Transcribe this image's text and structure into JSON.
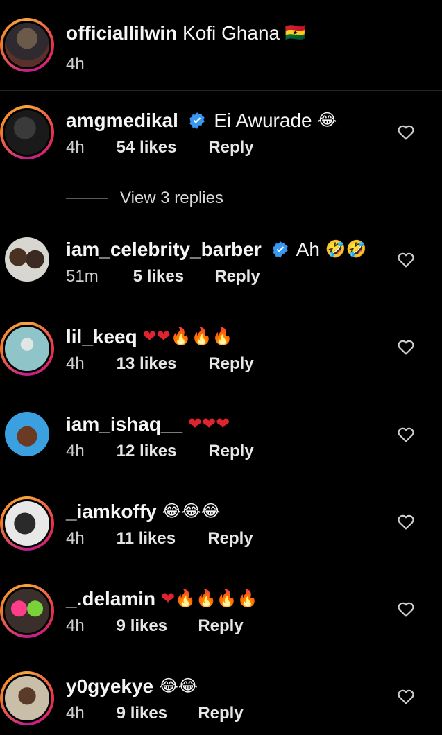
{
  "caption": {
    "username": "officiallilwin",
    "text": "Kofi Ghana",
    "flag_emoji": "🇬🇭",
    "time": "4h"
  },
  "view_replies_label": "View 3 replies",
  "reply_label": "Reply",
  "comments": [
    {
      "username": "amgmedikal",
      "verified": true,
      "text": "Ei Awurade",
      "emoji": "😂",
      "time": "4h",
      "likes": "54 likes"
    },
    {
      "username": "iam_celebrity_barber",
      "verified": true,
      "text": "Ah",
      "emoji": "🤣🤣",
      "time": "51m",
      "likes": "5 likes"
    },
    {
      "username": "lil_keeq",
      "verified": false,
      "text": "",
      "emoji": "❤❤🔥🔥🔥",
      "time": "4h",
      "likes": "13 likes"
    },
    {
      "username": "iam_ishaq__",
      "verified": false,
      "text": "",
      "emoji": "❤❤❤",
      "time": "4h",
      "likes": "12 likes"
    },
    {
      "username": "_iamkoffy",
      "verified": false,
      "text": "",
      "emoji": "😂😂😂",
      "time": "4h",
      "likes": "11 likes"
    },
    {
      "username": "_.delamin",
      "verified": false,
      "text": "",
      "emoji": "❤🔥🔥🔥🔥",
      "time": "4h",
      "likes": "9 likes"
    },
    {
      "username": "y0gyekye",
      "verified": false,
      "text": "",
      "emoji": "😂😂",
      "time": "4h",
      "likes": "9 likes"
    }
  ],
  "colors": {
    "background": "#000000",
    "verified_badge": "#3897f0",
    "story_ring": "#e8314a"
  }
}
